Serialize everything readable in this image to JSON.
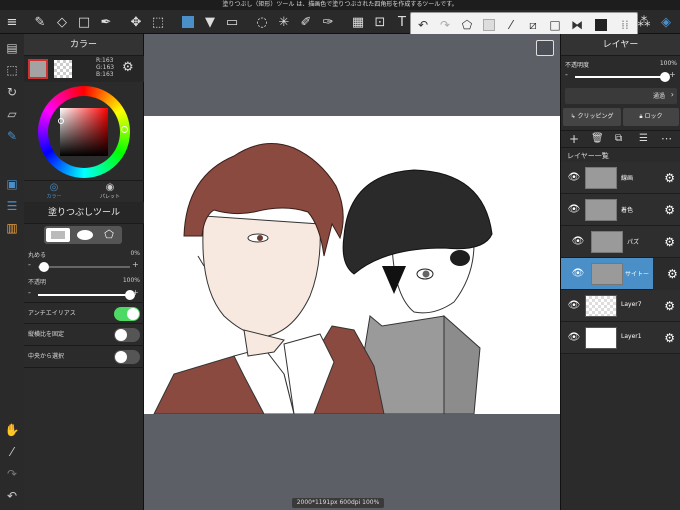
{
  "status_text": "塗りつぶし（矩形）ツール は、描画色で塗りつぶされた四角形を作成するツールです。",
  "left_panel": {
    "title": "カラー",
    "rgb": {
      "r": "R:163",
      "g": "G:163",
      "b": "B:163"
    },
    "tabs": [
      {
        "label": "カラー"
      },
      {
        "label": "パレット"
      }
    ],
    "tool_title": "塗りつぶしツール",
    "props": [
      {
        "label": "丸める",
        "value": "0%"
      },
      {
        "label": "不透明",
        "value": "100%"
      }
    ],
    "opacity_level_percent": 100,
    "round_level_percent": 0,
    "toggles": [
      {
        "label": "アンチエイリアス",
        "on": true
      },
      {
        "label": "縦横比を固定",
        "on": false
      },
      {
        "label": "中央から選択",
        "on": false
      }
    ]
  },
  "right_panel": {
    "title": "レイヤー",
    "opacity_label": "不透明度",
    "opacity_value": "100%",
    "blend_mode": "通過",
    "clipping_label": "クリッピング",
    "lock_label": "ロック",
    "layer_list_title": "レイヤー一覧",
    "layers": [
      {
        "name": "線画",
        "type": "folder",
        "selected": false
      },
      {
        "name": "着色",
        "type": "folder",
        "selected": false
      },
      {
        "name": "パズ",
        "type": "folder",
        "selected": false
      },
      {
        "name": "サイトー",
        "type": "folder",
        "selected": true
      },
      {
        "name": "Layer7",
        "type": "layer",
        "selected": false
      },
      {
        "name": "Layer1",
        "type": "layer",
        "selected": false
      }
    ]
  },
  "footer_text": "2000*1191px 600dpi 100%",
  "colors": {
    "accent": "#4a8fc7",
    "hair_brown": "#8a4a3f",
    "hat_black": "#2a2a2a",
    "skin": "#f7e9df"
  }
}
